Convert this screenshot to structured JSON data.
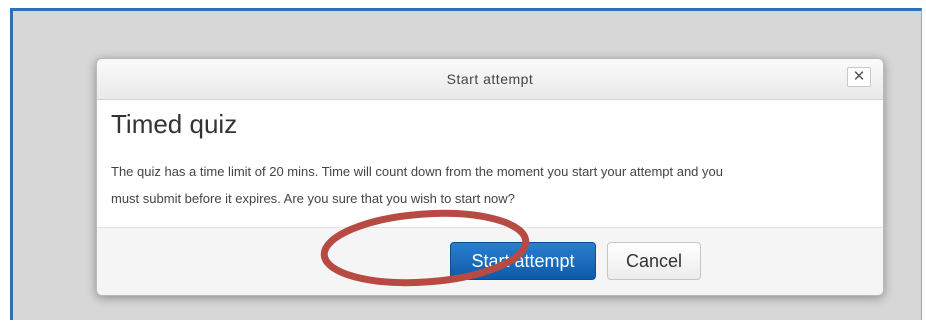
{
  "dialog": {
    "title": "Start attempt",
    "close_label": "✕",
    "heading": "Timed quiz",
    "message_line1": "The quiz has a time limit of 20 mins. Time will count down from the moment you start your attempt and you",
    "message_line2": "must submit before it expires. Are you sure that you wish to start now?",
    "start_button_label": "Start attempt",
    "cancel_button_label": "Cancel"
  },
  "colors": {
    "primary_button": "#1565c0",
    "annotation_circle": "#b84a44",
    "page_border": "#2f6fb6"
  },
  "icons": {
    "close": "close-icon"
  }
}
